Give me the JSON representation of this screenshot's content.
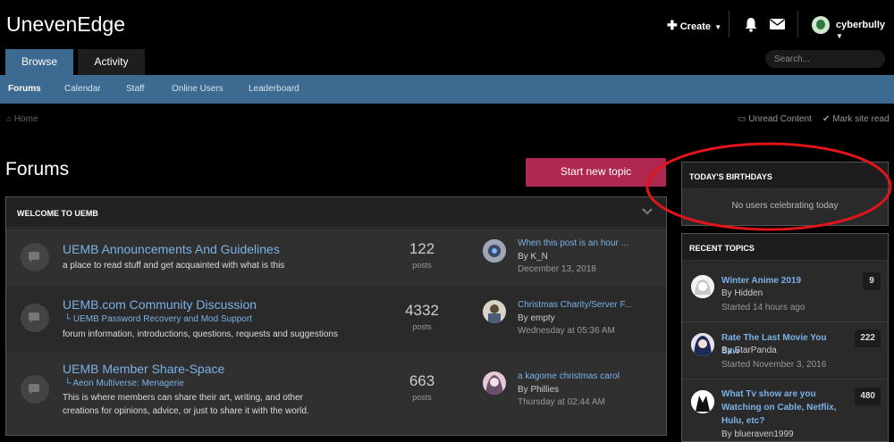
{
  "header": {
    "site_title": "UnevenEdge",
    "create_label": "Create",
    "username": "cyberbully",
    "icons": [
      "plus-icon",
      "bell-icon",
      "envelope-icon",
      "caret-down-icon"
    ]
  },
  "tabs": [
    {
      "label": "Browse",
      "active": true
    },
    {
      "label": "Activity",
      "active": false
    }
  ],
  "search": {
    "placeholder": "Search..."
  },
  "subnav": [
    "Forums",
    "Calendar",
    "Staff",
    "Online Users",
    "Leaderboard"
  ],
  "breadcrumb": {
    "home": "Home"
  },
  "utility": {
    "unread": "Unread Content",
    "mark_read": "Mark site read"
  },
  "page": {
    "title": "Forums",
    "new_topic": "Start new topic"
  },
  "category": {
    "label": "WELCOME TO UEMB"
  },
  "forums": [
    {
      "name": "UEMB Announcements And Guidelines",
      "subforum": "",
      "description": "a place to read stuff and get acquainted with what is this",
      "count": "122",
      "count_label": "posts",
      "last_title": "When this post is an hour ...",
      "last_by": "By K_N",
      "last_date": "December 13, 2018"
    },
    {
      "name": "UEMB.com Community Discussion",
      "subforum": "UEMB Password Recovery and Mod Support",
      "description": "forum information, introductions, questions, requests and suggestions",
      "count": "4332",
      "count_label": "posts",
      "last_title": "Christmas Charity/Server F...",
      "last_by": "By empty",
      "last_date": "Wednesday at 05:36 AM"
    },
    {
      "name": "UEMB Member Share-Space",
      "subforum": "Aeon Multiverse: Menagerie",
      "description": "This is where members can share their art, writing, and other creations for opinions, advice, or just to share it with the world.",
      "count": "663",
      "count_label": "posts",
      "last_title": "a kagome christmas carol",
      "last_by": "By Phillies",
      "last_date": "Thursday at 02:44 AM"
    }
  ],
  "sidebar": {
    "birthdays_title": "TODAY'S BIRTHDAYS",
    "birthdays_empty": "No users celebrating today",
    "recent_title": "RECENT TOPICS",
    "recent": [
      {
        "title": "Winter Anime 2019",
        "by": "By Hidden",
        "date": "Started 14 hours ago",
        "count": "9"
      },
      {
        "title": "Rate The Last Movie You Saw",
        "by": "By StarPanda",
        "date": "Started November 3, 2016",
        "count": "222"
      },
      {
        "title": "What Tv show are you Watching on Cable, Netflix, Hulu, etc?",
        "by": "By blueraven1999",
        "date": "",
        "count": "480"
      }
    ]
  },
  "colors": {
    "nav_blue": "#3d6a90",
    "button_pink": "#b0274f",
    "link_blue": "#7ab2e6",
    "annotation_red": "#e0141b"
  }
}
